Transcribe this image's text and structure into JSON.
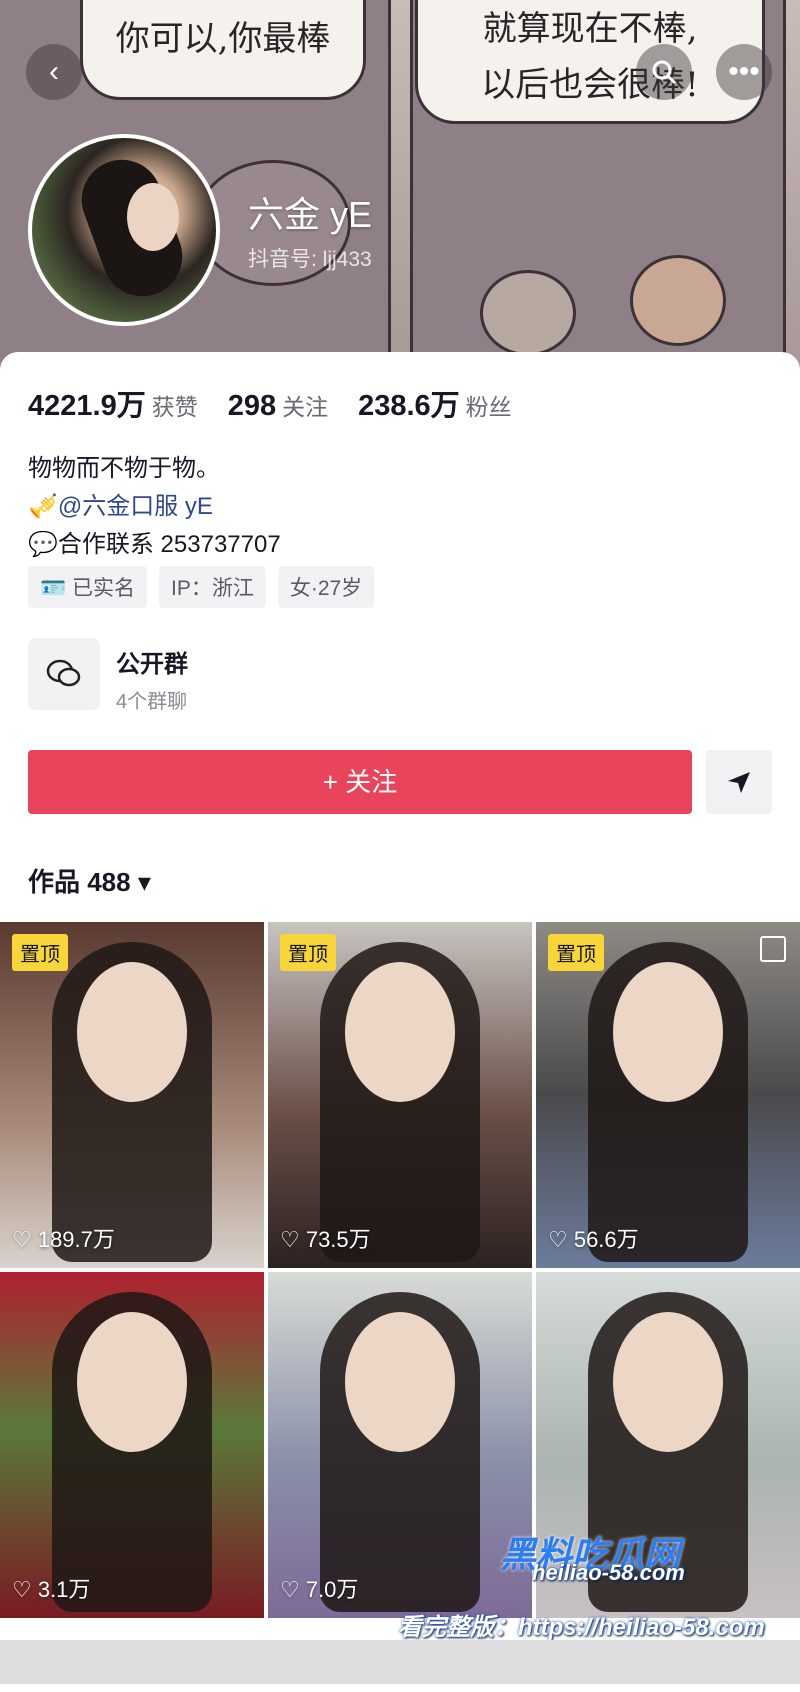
{
  "banner": {
    "bubble_left": "你可以,你最棒",
    "bubble_right_1": "就算现在不棒,",
    "bubble_right_2": "以后也会很棒!"
  },
  "topbar": {
    "back_icon": "chevron-left-icon",
    "search_icon": "search-icon",
    "more_icon": "more-dots-icon"
  },
  "profile": {
    "nickname": "六金 yE",
    "douyin_id": "抖音号: ljj433"
  },
  "stats": [
    {
      "value": "4221.9万",
      "label": "获赞"
    },
    {
      "value": "298",
      "label": "关注"
    },
    {
      "value": "238.6万",
      "label": "粉丝"
    }
  ],
  "bio": {
    "line1": "物物而不物于物。",
    "line2": "🎺@六金口服 yE",
    "line3": "💬合作联系 253737707"
  },
  "tags": [
    "🪪 已实名",
    "IP：浙江",
    "女·27岁"
  ],
  "group": {
    "title": "公开群",
    "subtitle": "4个群聊"
  },
  "actions": {
    "follow_label": "+ 关注"
  },
  "works": {
    "label": "作品 488 ▾"
  },
  "tiles": [
    {
      "pin": "置顶",
      "likes": "♡ 189.7万"
    },
    {
      "pin": "置顶",
      "likes": "♡ 73.5万"
    },
    {
      "pin": "置顶",
      "likes": "♡ 56.6万"
    },
    {
      "pin": "",
      "likes": "♡ 3.1万"
    },
    {
      "pin": "",
      "likes": "♡ 7.0万"
    },
    {
      "pin": "",
      "likes": ""
    }
  ],
  "watermark": {
    "brand": "黑料吃瓜网",
    "url": "heiliao-58.com",
    "caption": "看完整版：https://heiliao-58.com"
  }
}
